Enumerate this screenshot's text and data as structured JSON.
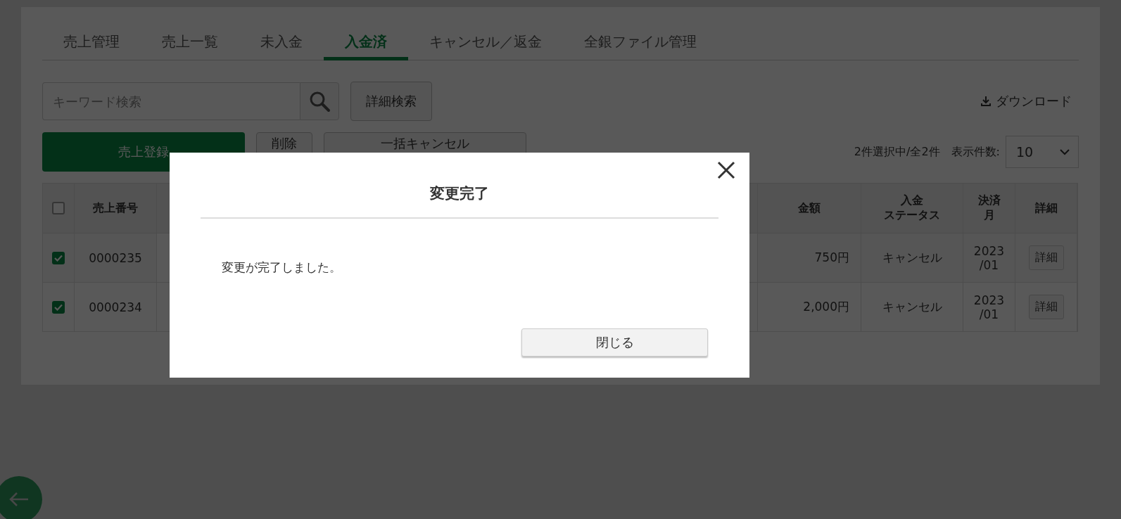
{
  "tabs": [
    {
      "label": "売上管理",
      "selected": false
    },
    {
      "label": "売上一覧",
      "selected": false
    },
    {
      "label": "未入金",
      "selected": false
    },
    {
      "label": "入金済",
      "selected": true
    },
    {
      "label": "キャンセル／返金",
      "selected": false
    },
    {
      "label": "全銀ファイル管理",
      "selected": false
    }
  ],
  "search": {
    "placeholder": "キーワード検索",
    "advanced_button": "詳細検索"
  },
  "download": "ダウンロード",
  "actions": {
    "register": "売上登録",
    "delete": "削除",
    "bulk_cancel": "一括キャンセル"
  },
  "selection_info": "2件選択中/全2件",
  "page_size": {
    "label": "表示件数:",
    "value": "10"
  },
  "table": {
    "select_all_checked": false,
    "columns": [
      [
        "売上番号"
      ],
      [
        "金額"
      ],
      [
        "入金",
        "ステータス"
      ],
      [
        "決済",
        "月"
      ],
      [
        "詳細"
      ]
    ],
    "rows": [
      {
        "checked": true,
        "number": "0000235",
        "amount": "750円",
        "status": "キャンセル",
        "month": "2023\n/01",
        "detail": "詳細"
      },
      {
        "checked": true,
        "number": "0000234",
        "amount": "2,000円",
        "status": "キャンセル",
        "month": "2023\n/01",
        "detail": "詳細"
      }
    ]
  },
  "modal": {
    "title": "変更完了",
    "message": "変更が完了しました。",
    "close_button": "閉じる"
  }
}
